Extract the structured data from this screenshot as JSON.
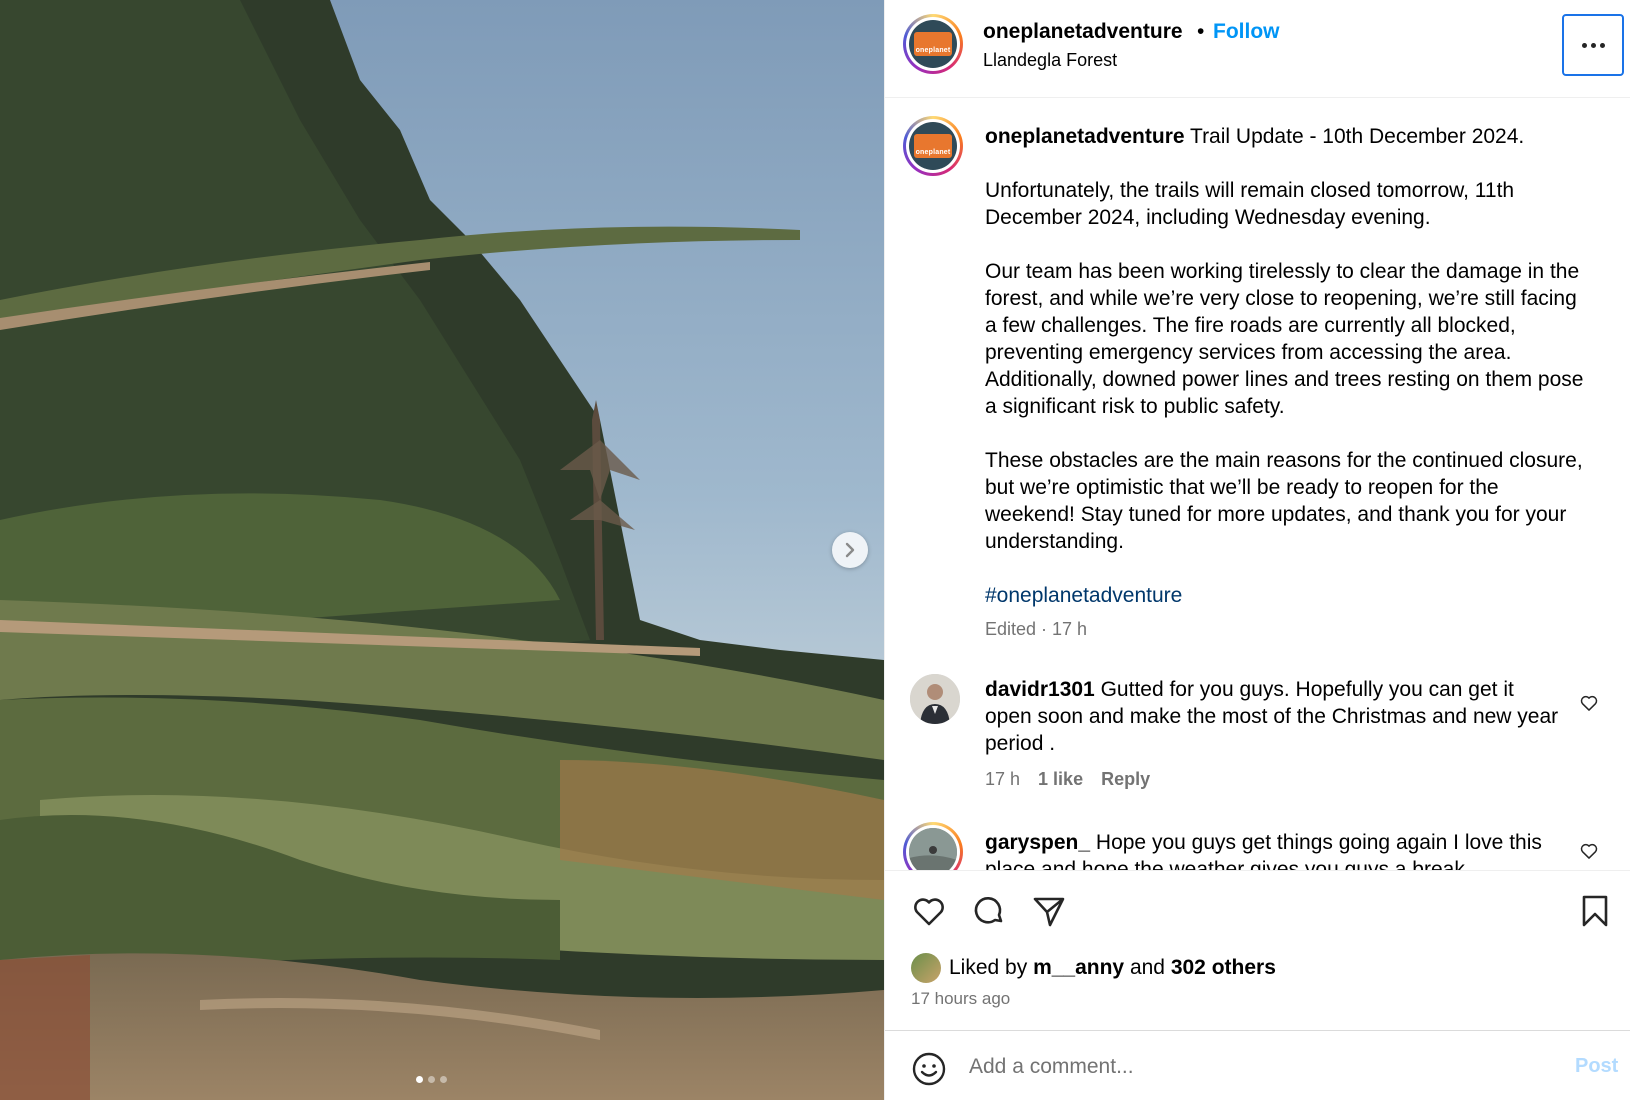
{
  "post": {
    "media": {
      "description_icon": "photo-fallen-trees",
      "next_icon": "chevron-right-icon",
      "carousel_count": 3,
      "carousel_active": 1
    },
    "header": {
      "username": "oneplanetadventure",
      "separator": "•",
      "follow_label": "Follow",
      "location": "Llandegla Forest",
      "avatar_logo_text": "oneplanet",
      "more_icon": "more-horizontal-icon"
    },
    "caption": {
      "username": "oneplanetadventure",
      "first_line": "Trail Update - 10th December 2024.",
      "para1": "Unfortunately, the trails will remain closed tomorrow, 11th December 2024, including Wednesday evening.",
      "para2": "Our team has been working tirelessly to clear the damage in the forest, and while we’re very close to reopening, we’re still facing a few challenges. The fire roads are currently all blocked, preventing emergency services from accessing the area. Additionally, downed power lines and trees resting on them pose a significant risk to public safety.",
      "para3": "These obstacles are the main reasons for the continued closure, but we’re optimistic that we’ll be ready to reopen for the weekend! Stay tuned for more updates, and thank you for your understanding.",
      "hashtag": "#oneplanetadventure",
      "meta": "Edited · 17 h"
    },
    "comments": [
      {
        "username": "davidr1301",
        "text": "Gutted for you guys. Hopefully you can get it open soon and make the most of the Christmas and new year period .",
        "time": "17 h",
        "likes": "1 like",
        "reply_label": "Reply"
      },
      {
        "username": "garyspen_",
        "text": "Hope you guys get things going again I love this place and hope the weather gives you guys a break"
      }
    ],
    "actions": {
      "like_icon": "heart-icon",
      "comment_icon": "comment-bubble-icon",
      "share_icon": "paper-plane-icon",
      "save_icon": "bookmark-icon"
    },
    "likes": {
      "prefix": "Liked by ",
      "user": "m__anny",
      "middle": " and ",
      "others": "302 others"
    },
    "time_ago": "17 hours ago",
    "add_comment": {
      "placeholder": "Add a comment...",
      "post_label": "Post",
      "emoji_icon": "emoji-icon"
    },
    "colors": {
      "follow_blue": "#0095f6",
      "hashtag": "#00376b",
      "muted": "#737373",
      "post_disabled": "#b3dbff"
    }
  }
}
